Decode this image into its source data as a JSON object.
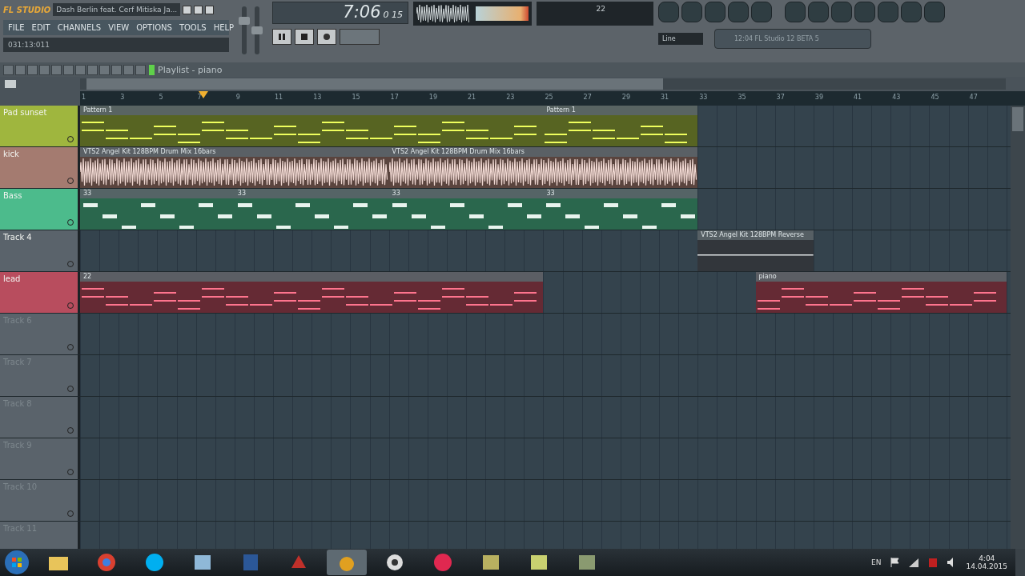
{
  "title_bar": {
    "logo": "FL STUDIO",
    "song_title": "Dash Berlin feat. Cerf Mitiska Ja..."
  },
  "menu": [
    "FILE",
    "EDIT",
    "CHANNELS",
    "VIEW",
    "OPTIONS",
    "TOOLS",
    "HELP"
  ],
  "hint_bar": "031:13:011",
  "mixer_sliders": [
    {
      "level": 0.75
    },
    {
      "level": 0.5
    }
  ],
  "transport": {
    "time": "7:06",
    "time_small": "0 15"
  },
  "cpu_meter": {
    "reading": "22"
  },
  "snap": {
    "value": "Line"
  },
  "browser_field": {
    "value": "12:04 FL Studio 12 BETA 5"
  },
  "playlist": {
    "title": "Playlist - piano",
    "ruler": [
      "1",
      "3",
      "5",
      "7",
      "9",
      "11",
      "13",
      "15",
      "17",
      "19",
      "21",
      "23",
      "25",
      "27",
      "29",
      "31",
      "33",
      "35",
      "37",
      "39",
      "41",
      "43",
      "45",
      "47"
    ],
    "tracks": [
      {
        "name": "Pad sunset",
        "color": "#9fb63e",
        "clips": [
          {
            "label": "Pattern 1",
            "kind": "notes"
          },
          {
            "label": "Pattern 1",
            "kind": "notes"
          }
        ]
      },
      {
        "name": "kick",
        "color": "#a47b70",
        "clips": [
          {
            "label": "VTS2 Angel Kit 128BPM Drum Mix 16bars",
            "kind": "audio"
          },
          {
            "label": "VTS2 Angel Kit 128BPM Drum Mix 16bars",
            "kind": "audio"
          }
        ]
      },
      {
        "name": "Bass",
        "color": "#4cbb8c",
        "clips": [
          {
            "label": "33",
            "kind": "blocks"
          },
          {
            "label": "33",
            "kind": "blocks"
          },
          {
            "label": "33",
            "kind": "blocks"
          },
          {
            "label": "33",
            "kind": "blocks"
          }
        ]
      },
      {
        "name": "Track 4",
        "color": "#5a636b",
        "clips": [
          {
            "label": "VTS2 Angel Kit 128BPM Reverse",
            "kind": "audio-quiet"
          }
        ]
      },
      {
        "name": "lead",
        "color": "#b84d5e",
        "clips": [
          {
            "label": "22",
            "kind": "notes"
          },
          {
            "label": "piano",
            "kind": "notes"
          }
        ]
      },
      {
        "name": "Track 6",
        "color": "#5a636b"
      },
      {
        "name": "Track 7",
        "color": "#5a636b"
      },
      {
        "name": "Track 8",
        "color": "#5a636b"
      },
      {
        "name": "Track 9",
        "color": "#5a636b"
      },
      {
        "name": "Track 10",
        "color": "#5a636b"
      },
      {
        "name": "Track 11",
        "color": "#5a636b"
      }
    ]
  },
  "taskbar": {
    "language": "EN",
    "time": "4:04",
    "date": "14.04.2015"
  }
}
